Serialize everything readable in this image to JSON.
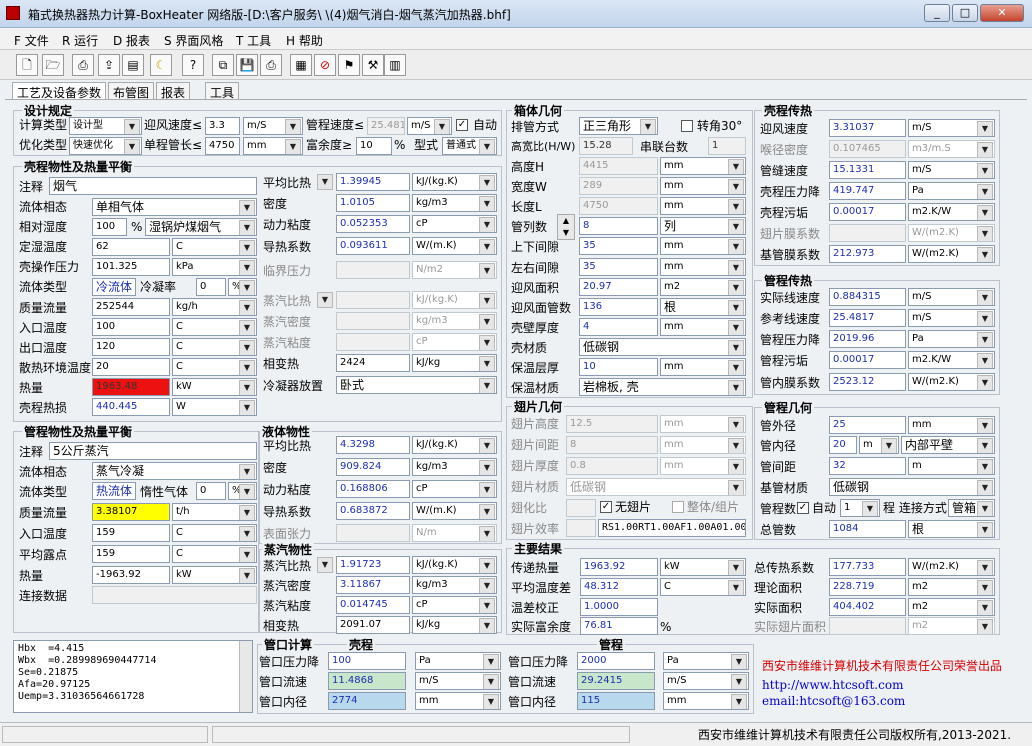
{
  "window": {
    "title": "箱式换热器热力计算-BoxHeater 网络版-[D:\\客户服务\\        \\(4)烟气消白-烟气蒸汽加热器.bhf]",
    "colors": {
      "red_field": "#ee1111",
      "yellow_field": "#ffff00",
      "green_field": "#c8e6c9",
      "blue_field": "#b8d8ee",
      "link": "#0000cc",
      "company": "#d40000"
    }
  },
  "menu": [
    "F 文件",
    "R 运行",
    "D 报表",
    "S 界面风格",
    "T 工具",
    "H 帮助"
  ],
  "toolbar_icons": [
    "new-file-icon",
    "open-file-icon",
    "print-preview-icon",
    "export-icon",
    "report-icon",
    "moon-icon",
    "help-cursor-icon",
    "copy-icon",
    "save-icon",
    "print-icon",
    "calculate-icon",
    "stop-icon",
    "flag-icon",
    "tools-icon",
    "database-icon"
  ],
  "tabs": [
    "工艺及设备参数",
    "布管图",
    "报表",
    "工具"
  ],
  "design": {
    "title": "设计规定",
    "calc_type_label": "计算类型",
    "calc_type": "设计型",
    "face_vel_label": "迎风速度≤",
    "face_vel": "3.3",
    "face_vel_unit": "m/S",
    "tube_vel_label": "管程速度≤",
    "tube_vel": "25.4817",
    "tube_vel_unit": "m/S",
    "auto_label": "自动",
    "opt_type_label": "优化类型",
    "opt_type": "快速优化",
    "tube_len_label": "单程管长≤",
    "tube_len": "4750",
    "tube_len_unit": "mm",
    "margin_label": "富余度≥",
    "margin": "10",
    "margin_unit": "%",
    "type_label": "型式",
    "type": "普通式"
  },
  "shell_props": {
    "title": "壳程物性及热量平衡",
    "rows": [
      {
        "label": "注释",
        "value": "烟气"
      },
      {
        "label": "流体相态",
        "value": "单相气体"
      },
      {
        "label": "相对湿度",
        "value": "100",
        "unit": "%",
        "extra": "湿锅炉煤烟气"
      },
      {
        "label": "定湿温度",
        "value": "62",
        "unit": "C"
      },
      {
        "label": "壳操作压力",
        "value": "101.325",
        "unit": "kPa"
      },
      {
        "label": "流体类型",
        "value": "冷流体",
        "extra_label": "冷凝率",
        "extra": "0",
        "extra_unit": "%"
      },
      {
        "label": "质量流量",
        "value": "252544",
        "unit": "kg/h"
      },
      {
        "label": "入口温度",
        "value": "100",
        "unit": "C"
      },
      {
        "label": "出口温度",
        "value": "120",
        "unit": "C"
      },
      {
        "label": "散热环境温度",
        "value": "20",
        "unit": "C"
      },
      {
        "label": "热量",
        "value": "1963.48",
        "unit": "kW"
      },
      {
        "label": "壳程热损",
        "value": "440.445",
        "unit": "W"
      }
    ],
    "right": [
      {
        "label": "平均比热",
        "value": "1.39945",
        "unit": "kJ/(kg.K)"
      },
      {
        "label": "密度",
        "value": "1.0105",
        "unit": "kg/m3"
      },
      {
        "label": "动力粘度",
        "value": "0.052353",
        "unit": "cP"
      },
      {
        "label": "导热系数",
        "value": "0.093611",
        "unit": "W/(m.K)"
      },
      {
        "label": "临界压力",
        "value": "",
        "unit": "N/m2"
      },
      {
        "label": "蒸汽比热",
        "value": "",
        "unit": "kJ/(kg.K)"
      },
      {
        "label": "蒸汽密度",
        "value": "",
        "unit": "kg/m3"
      },
      {
        "label": "蒸汽粘度",
        "value": "",
        "unit": "cP"
      },
      {
        "label": "相变热",
        "value": "2424",
        "unit": "kJ/kg"
      },
      {
        "label": "冷凝器放置",
        "value": "卧式"
      }
    ]
  },
  "tube_props": {
    "title": "管程物性及热量平衡",
    "rows": [
      {
        "label": "注释",
        "value": "5公斤蒸汽"
      },
      {
        "label": "流体相态",
        "value": "蒸气冷凝"
      },
      {
        "label": "流体类型",
        "value": "热流体",
        "extra_label": "惰性气体",
        "extra": "0",
        "extra_unit": "%"
      },
      {
        "label": "质量流量",
        "value": "3.38107",
        "unit": "t/h"
      },
      {
        "label": "入口温度",
        "value": "159",
        "unit": "C"
      },
      {
        "label": "平均露点",
        "value": "159",
        "unit": "C"
      },
      {
        "label": "热量",
        "value": "-1963.92",
        "unit": "kW"
      },
      {
        "label": "连接数据",
        "value": ""
      }
    ]
  },
  "liquid": {
    "title": "液体物性",
    "rows": [
      {
        "label": "平均比热",
        "value": "4.3298",
        "unit": "kJ/(kg.K)"
      },
      {
        "label": "密度",
        "value": "909.824",
        "unit": "kg/m3"
      },
      {
        "label": "动力粘度",
        "value": "0.168806",
        "unit": "cP"
      },
      {
        "label": "导热系数",
        "value": "0.683872",
        "unit": "W/(m.K)"
      },
      {
        "label": "表面张力",
        "value": "",
        "unit": "N/m"
      }
    ]
  },
  "vapor": {
    "title": "蒸汽物性",
    "rows": [
      {
        "label": "蒸汽比热",
        "value": "1.91723",
        "unit": "kJ/(kg.K)"
      },
      {
        "label": "蒸汽密度",
        "value": "3.11867",
        "unit": "kg/m3"
      },
      {
        "label": "蒸汽粘度",
        "value": "0.014745",
        "unit": "cP"
      },
      {
        "label": "相变热",
        "value": "2091.07",
        "unit": "kJ/kg"
      }
    ]
  },
  "box_geom": {
    "title": "箱体几何",
    "layout_label": "排管方式",
    "layout": "正三角形",
    "rotate_label": "转角30°",
    "hw_label": "高宽比(H/W)",
    "hw": "15.28",
    "series_label": "串联台数",
    "series": "1",
    "rows": [
      {
        "label": "高度H",
        "value": "4415",
        "unit": "mm"
      },
      {
        "label": "宽度W",
        "value": "289",
        "unit": "mm"
      },
      {
        "label": "长度L",
        "value": "4750",
        "unit": "mm"
      },
      {
        "label": "管列数",
        "value": "8",
        "unit": "列"
      },
      {
        "label": "上下间隙",
        "value": "35",
        "unit": "mm"
      },
      {
        "label": "左右间隙",
        "value": "35",
        "unit": "mm"
      },
      {
        "label": "迎风面积",
        "value": "20.97",
        "unit": "m2"
      },
      {
        "label": "迎风面管数",
        "value": "136",
        "unit": "根"
      },
      {
        "label": "壳壁厚度",
        "value": "4",
        "unit": "mm"
      },
      {
        "label": "壳材质",
        "value": "低碳钢"
      },
      {
        "label": "保温层厚",
        "value": "10",
        "unit": "mm"
      },
      {
        "label": "保温材质",
        "value": "岩棉板, 壳"
      }
    ]
  },
  "fin_geom": {
    "title": "翅片几何",
    "rows": [
      {
        "label": "翅片高度",
        "value": "12.5",
        "unit": "mm"
      },
      {
        "label": "翅片间距",
        "value": "8",
        "unit": "mm"
      },
      {
        "label": "翅片厚度",
        "value": "0.8",
        "unit": "mm"
      },
      {
        "label": "翅片材质",
        "value": "低碳钢"
      }
    ],
    "ratio_label": "翅化比",
    "no_fin_label": "无翅片",
    "whole_label": "整体/组片",
    "eff_label": "翅片效率",
    "eff_code": "RS1.00RT1.00AF1.00A01.00"
  },
  "results": {
    "title": "主要结果",
    "rows": [
      {
        "label": "传递热量",
        "value": "1963.92",
        "unit": "kW"
      },
      {
        "label": "平均温度差",
        "value": "48.312",
        "unit": "C"
      },
      {
        "label": "温差校正",
        "value": "1.0000"
      },
      {
        "label": "实际富余度",
        "value": "76.81",
        "unit": "%"
      }
    ],
    "right": [
      {
        "label": "总传热系数",
        "value": "177.733",
        "unit": "W/(m2.K)"
      },
      {
        "label": "理论面积",
        "value": "228.719",
        "unit": "m2"
      },
      {
        "label": "实际面积",
        "value": "404.402",
        "unit": "m2"
      },
      {
        "label": "实际翅片面积",
        "value": "",
        "unit": "m2"
      }
    ]
  },
  "shell_ht": {
    "title": "壳程传热",
    "rows": [
      {
        "label": "迎风速度",
        "value": "3.31037",
        "unit": "m/S"
      },
      {
        "label": "喉径密度",
        "value": "0.107465",
        "unit": "m3/m.S"
      },
      {
        "label": "管缝速度",
        "value": "15.1331",
        "unit": "m/S"
      },
      {
        "label": "壳程压力降",
        "value": "419.747",
        "unit": "Pa"
      },
      {
        "label": "壳程污垢",
        "value": "0.00017",
        "unit": "m2.K/W"
      },
      {
        "label": "翅片膜系数",
        "value": "",
        "unit": "W/(m2.K)"
      },
      {
        "label": "基管膜系数",
        "value": "212.973",
        "unit": "W/(m2.K)"
      }
    ]
  },
  "tube_ht": {
    "title": "管程传热",
    "rows": [
      {
        "label": "实际线速度",
        "value": "0.884315",
        "unit": "m/S"
      },
      {
        "label": "参考线速度",
        "value": "25.4817",
        "unit": "m/S"
      },
      {
        "label": "管程压力降",
        "value": "2019.96",
        "unit": "Pa"
      },
      {
        "label": "管程污垢",
        "value": "0.00017",
        "unit": "m2.K/W"
      },
      {
        "label": "管内膜系数",
        "value": "2523.12",
        "unit": "W/(m2.K)"
      }
    ]
  },
  "tube_geom": {
    "title": "管程几何",
    "od_label": "管外径",
    "od": "25",
    "od_unit": "mm",
    "id_label": "管内径",
    "id": "20",
    "id_unit": "m",
    "wall_type": "内部平壁",
    "pitch_label": "管间距",
    "pitch": "32",
    "pitch_unit": "m",
    "mat_label": "基管材质",
    "mat": "低碳钢",
    "passes_label": "管程数",
    "auto_label": "自动",
    "passes": "1",
    "conn_label": "程 连接方式",
    "conn": "管箱",
    "total_label": "总管数",
    "total": "1084",
    "total_unit": "根"
  },
  "nozzle": {
    "title": "管口计算",
    "shell_title": "壳程",
    "tube_title": "管程",
    "shell": [
      {
        "label": "管口压力降",
        "value": "100",
        "unit": "Pa"
      },
      {
        "label": "管口流速",
        "value": "11.4868",
        "unit": "m/S"
      },
      {
        "label": "管口内径",
        "value": "2774",
        "unit": "mm"
      }
    ],
    "tube": [
      {
        "label": "管口压力降",
        "value": "2000",
        "unit": "Pa"
      },
      {
        "label": "管口流速",
        "value": "29.2415",
        "unit": "m/S"
      },
      {
        "label": "管口内径",
        "value": "115",
        "unit": "mm"
      }
    ]
  },
  "log": "Hbx  =4.415\nWbx  =0.289989690447714\nSe=0.21875\nAfa=20.97125\nUemp=3.31036564661728",
  "company": {
    "credit": "西安市维维计算机技术有限责任公司荣誉出品",
    "url": "http://www.htcsoft.com",
    "email": "email:htcsoft@163.com"
  },
  "status": {
    "copyright": "西安市维维计算机技术有限责任公司版权所有,2013-2021."
  }
}
